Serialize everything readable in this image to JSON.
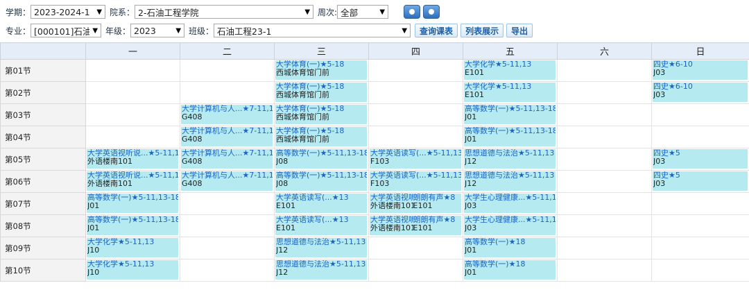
{
  "filters": {
    "term_label": "学期：",
    "term_value": "2023-2024-1",
    "dept_label": "院系：",
    "dept_value": "2-石油工程学院",
    "week_label": "周次:",
    "week_value": "全部",
    "major_label": "专业：",
    "major_value": "[000101]石油工程",
    "grade_label": "年级：",
    "grade_value": "2023",
    "class_label": "班级：",
    "class_value": "石油工程23-1",
    "query_button": "查询课表",
    "list_button": "列表展示",
    "export_button": "导出"
  },
  "days": [
    "一",
    "二",
    "三",
    "四",
    "五",
    "六",
    "日"
  ],
  "sections": [
    "第01节",
    "第02节",
    "第03节",
    "第04节",
    "第05节",
    "第06节",
    "第07节",
    "第08节",
    "第09节",
    "第10节"
  ],
  "schedule": {
    "r1": {
      "c3": {
        "title": "大学体育(一)★5-18",
        "loc": "西城体育馆门前"
      },
      "c5": {
        "title": "大学化学★5-11,13",
        "loc": "E101"
      },
      "c7": {
        "title": "四史★6-10",
        "loc": "J03"
      }
    },
    "r2": {
      "c3": {
        "title": "大学体育(一)★5-18",
        "loc": "西城体育馆门前"
      },
      "c5": {
        "title": "大学化学★5-11,13",
        "loc": "E101"
      },
      "c7": {
        "title": "四史★6-10",
        "loc": "J03"
      }
    },
    "r3": {
      "c2": {
        "title": "大学计算机与人...★7-11,1",
        "loc": "G408"
      },
      "c3": {
        "title": "大学体育(一)★5-18",
        "loc": "西城体育馆门前"
      },
      "c5": {
        "title": "高等数学(一)★5-11,13-18",
        "loc": "J01"
      }
    },
    "r4": {
      "c2": {
        "title": "大学计算机与人...★7-11,1",
        "loc": "G408"
      },
      "c3": {
        "title": "大学体育(一)★5-18",
        "loc": "西城体育馆门前"
      },
      "c5": {
        "title": "高等数学(一)★5-11,13-18",
        "loc": "J01"
      }
    },
    "r5": {
      "c1": {
        "title": "大学英语视听说...★5-11,1",
        "loc": "外语楼南101"
      },
      "c2": {
        "title": "大学计算机与人...★7-11,1",
        "loc": "G408"
      },
      "c3": {
        "title": "高等数学(一)★5-11,13-18",
        "loc": "J08"
      },
      "c4": {
        "title": "大学英语读写(...★5-11,13",
        "loc": "F103"
      },
      "c5": {
        "title": "思想道德与法治★5-11,13",
        "loc": "J12"
      },
      "c7": {
        "title": "四史★5",
        "loc": "J03"
      }
    },
    "r6": {
      "c1": {
        "title": "大学英语视听说...★5-11,1",
        "loc": "外语楼南101"
      },
      "c2": {
        "title": "大学计算机与人...★7-11,1",
        "loc": "G408"
      },
      "c3": {
        "title": "高等数学(一)★5-11,13-18",
        "loc": "J08"
      },
      "c4": {
        "title": "大学英语读写(...★5-11,13",
        "loc": "F103"
      },
      "c5": {
        "title": "思想道德与法治★5-11,13",
        "loc": "J12"
      },
      "c7": {
        "title": "四史★5",
        "loc": "J03"
      }
    },
    "r7": {
      "c1": {
        "title": "高等数学(一)★5-11,13-18",
        "loc": "J01"
      },
      "c3": {
        "title": "大学英语读写(...★13",
        "loc": "E101"
      },
      "c4a": {
        "title": "大学英语视听",
        "loc": "外语楼南101"
      },
      "c4b": {
        "title": "朗朗有声★8",
        "loc": "E101"
      },
      "c5": {
        "title": "大学生心理健康...★5-11,1",
        "loc": "J03"
      }
    },
    "r8": {
      "c1": {
        "title": "高等数学(一)★5-11,13-18",
        "loc": "J01"
      },
      "c3": {
        "title": "大学英语读写(...★13",
        "loc": "E101"
      },
      "c4a": {
        "title": "大学英语视听",
        "loc": "外语楼南101"
      },
      "c4b": {
        "title": "朗朗有声★8",
        "loc": "E101"
      },
      "c5": {
        "title": "大学生心理健康...★5-11,1",
        "loc": "J03"
      }
    },
    "r9": {
      "c1": {
        "title": "大学化学★5-11,13",
        "loc": "J10"
      },
      "c3": {
        "title": "思想道德与法治★5-11,13",
        "loc": "J12"
      },
      "c5": {
        "title": "高等数学(一)★18",
        "loc": "J01"
      }
    },
    "r10": {
      "c1": {
        "title": "大学化学★5-11,13",
        "loc": "J10"
      },
      "c3": {
        "title": "思想道德与法治★5-11,13",
        "loc": "J12"
      },
      "c5": {
        "title": "高等数学(一)★18",
        "loc": "J01"
      }
    }
  }
}
